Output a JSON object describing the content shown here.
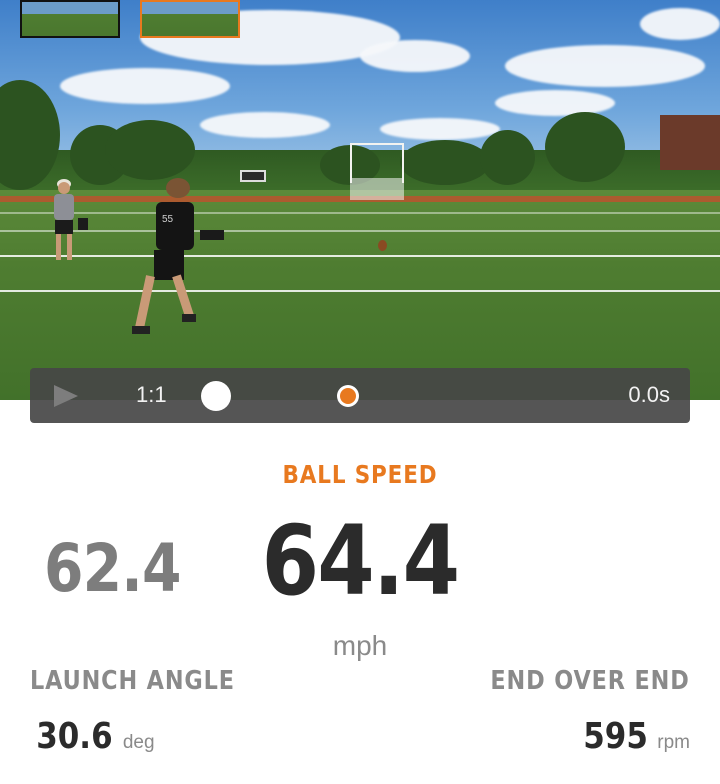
{
  "playback": {
    "speed": "1:1",
    "time": "0.0s",
    "play_icon": "play-icon"
  },
  "ball_speed": {
    "label": "BALL SPEED",
    "value": "64.4",
    "unit": "mph"
  },
  "side_value": "62.4",
  "launch_angle": {
    "label": "LAUNCH ANGLE",
    "value": "30.6",
    "unit": "deg"
  },
  "end_over_end": {
    "label": "END OVER END",
    "value": "595",
    "unit": "rpm"
  },
  "colors": {
    "accent": "#e8791f",
    "dark_text": "#2b2b2b",
    "muted_text": "#8a8a8a",
    "control_bar": "#464646"
  }
}
